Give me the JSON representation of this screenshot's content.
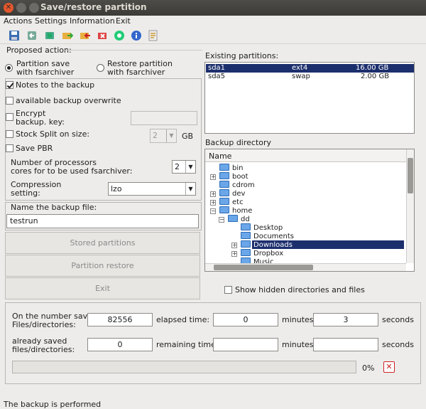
{
  "window": {
    "title": "Save/restore partition"
  },
  "menu": [
    "Actions",
    "Settings",
    "Information",
    "Exit"
  ],
  "toolbar": {
    "icons": [
      "save-icon",
      "restore-icon",
      "partition-icon",
      "folder-forward-icon",
      "folder-back-icon",
      "refresh-icon",
      "info-icon",
      "help-icon",
      "edit-icon"
    ]
  },
  "proposed_action": {
    "heading": "Proposed action:",
    "radio_save": "Partition save\nwith fsarchiver",
    "radio_save_line1": "Partition save",
    "radio_save_line2": "with fsarchiver",
    "radio_restore_line1": "Restore partition",
    "radio_restore_line2": "with fsarchiver",
    "selected": "save"
  },
  "options": {
    "notes": "Notes to  the backup",
    "notes_checked": true,
    "overwrite": "available backup overwrite",
    "overwrite_checked": false,
    "encrypt_line1": "Encrypt",
    "encrypt_line2": "backup. key:",
    "encrypt_checked": false,
    "split": "Stock Split on size:",
    "split_checked": false,
    "split_value": "2",
    "split_unit": "GB",
    "pbr": "Save PBR",
    "pbr_checked": false,
    "processors_line1": "Number of processors",
    "processors_line2": "cores for to be used fsarchiver:",
    "processors_value": "2",
    "compression_line1": "Compression",
    "compression_line2": "setting:",
    "compression_value": "lzo"
  },
  "backup_file": {
    "label": "Name the backup file:",
    "value": "testrun"
  },
  "buttons": {
    "stored": "Stored partitions",
    "restore": "Partition restore",
    "exit": "Exit"
  },
  "existing": {
    "label": "Existing partitions:",
    "rows": [
      {
        "name": "sda1",
        "fs": "ext4",
        "size": "16.00 GB",
        "selected": true
      },
      {
        "name": "sda5",
        "fs": "swap",
        "size": "2.00 GB",
        "selected": false
      }
    ]
  },
  "backup_dir": {
    "label": "Backup directory",
    "column": "Name",
    "tree": [
      {
        "name": "bin",
        "depth": 0,
        "expander": ""
      },
      {
        "name": "boot",
        "depth": 0,
        "expander": "+"
      },
      {
        "name": "cdrom",
        "depth": 0,
        "expander": ""
      },
      {
        "name": "dev",
        "depth": 0,
        "expander": "+"
      },
      {
        "name": "etc",
        "depth": 0,
        "expander": "+"
      },
      {
        "name": "home",
        "depth": 0,
        "expander": "-"
      },
      {
        "name": "dd",
        "depth": 1,
        "expander": "-"
      },
      {
        "name": "Desktop",
        "depth": 2,
        "expander": ""
      },
      {
        "name": "Documents",
        "depth": 2,
        "expander": ""
      },
      {
        "name": "Downloads",
        "depth": 2,
        "expander": "+",
        "selected": true
      },
      {
        "name": "Dropbox",
        "depth": 2,
        "expander": "+"
      },
      {
        "name": "Music",
        "depth": 2,
        "expander": ""
      }
    ],
    "show_hidden": "Show hidden directories and files",
    "show_hidden_checked": false
  },
  "progress": {
    "saved_label_line1": "On the number saved",
    "saved_label_line2": "Files/directories:",
    "saved_value": "82556",
    "elapsed_label": "elapsed time:",
    "elapsed_minutes": "0",
    "minutes_label": "minutes",
    "elapsed_seconds": "3",
    "seconds_label": "seconds",
    "already_label_line1": "already saved",
    "already_label_line2": "files/directories:",
    "already_value": "0",
    "remaining_label": "remaining time:",
    "remaining_minutes": "",
    "remaining_seconds": "",
    "percent": "0%",
    "fraction": 0
  },
  "status": "The backup is performed",
  "colors": {
    "selection": "#1c2f6d",
    "accent": "#e2572d"
  }
}
